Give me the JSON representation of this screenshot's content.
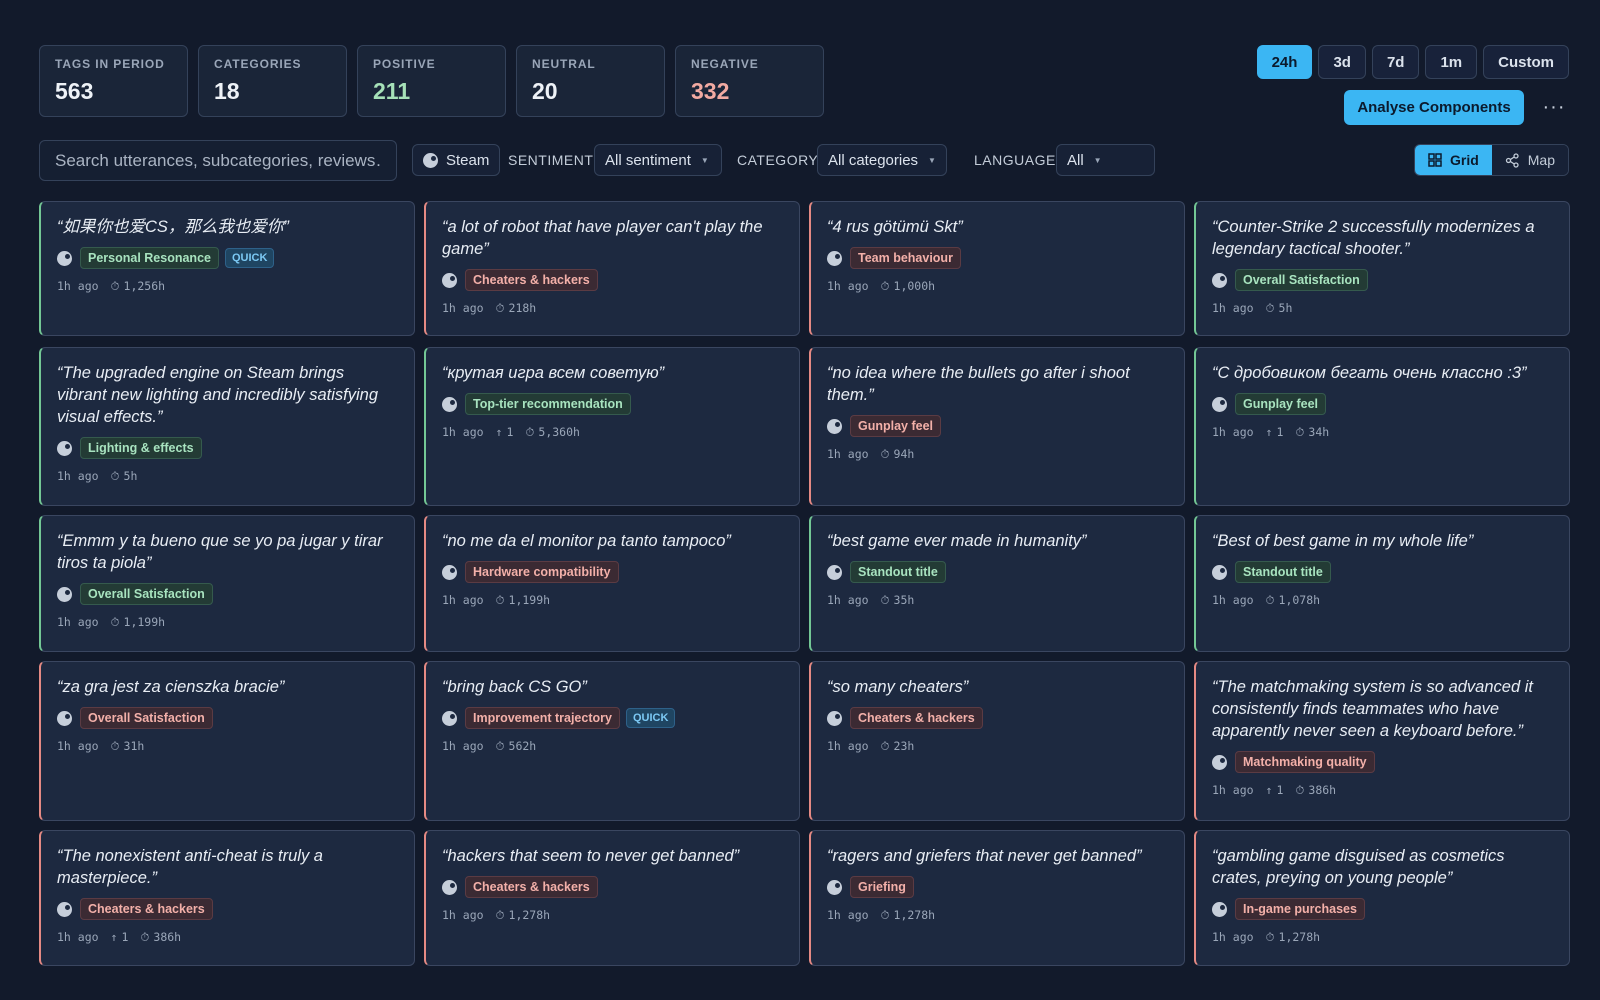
{
  "stats": [
    {
      "label": "TAGS IN PERIOD",
      "value": "563",
      "tone": ""
    },
    {
      "label": "CATEGORIES",
      "value": "18",
      "tone": ""
    },
    {
      "label": "POSITIVE",
      "value": "211",
      "tone": "pos"
    },
    {
      "label": "NEUTRAL",
      "value": "20",
      "tone": ""
    },
    {
      "label": "NEGATIVE",
      "value": "332",
      "tone": "neg"
    }
  ],
  "range": {
    "options": [
      "24h",
      "3d",
      "7d",
      "1m",
      "Custom"
    ],
    "active": "24h"
  },
  "analyse_label": "Analyse Components",
  "more_label": "···",
  "search": {
    "placeholder": "Search utterances, subcategories, reviews…"
  },
  "filters": {
    "source_chip": "Steam",
    "sentiment_label": "SENTIMENT",
    "sentiment_value": "All sentiment",
    "category_label": "CATEGORY",
    "category_value": "All categories",
    "language_label": "LANGUAGE",
    "language_value": "All"
  },
  "view": {
    "grid_label": "Grid",
    "map_label": "Map"
  },
  "cards": [
    {
      "quote": "“如果你也爱CS，那么我也爱你”",
      "tag": "Personal Resonance",
      "sentiment": "pos",
      "quick": "QUICK",
      "time": "1h ago",
      "up": "",
      "playtime": "1,256h"
    },
    {
      "quote": "“a lot of robot that have player can't play the game”",
      "tag": "Cheaters & hackers",
      "sentiment": "neg",
      "quick": "",
      "time": "1h ago",
      "up": "",
      "playtime": "218h"
    },
    {
      "quote": "“4 rus götümü Skt”",
      "tag": "Team behaviour",
      "sentiment": "neg",
      "quick": "",
      "time": "1h ago",
      "up": "",
      "playtime": "1,000h"
    },
    {
      "quote": "“Counter-Strike 2 successfully modernizes a legendary tactical shooter.”",
      "tag": "Overall Satisfaction",
      "sentiment": "pos",
      "quick": "",
      "time": "1h ago",
      "up": "",
      "playtime": "5h"
    },
    {
      "quote": "“The upgraded engine on Steam brings vibrant new lighting and incredibly satisfying visual effects.”",
      "tag": "Lighting & effects",
      "sentiment": "pos",
      "quick": "",
      "time": "1h ago",
      "up": "",
      "playtime": "5h"
    },
    {
      "quote": "“крутая игра всем советую”",
      "tag": "Top-tier recommendation",
      "sentiment": "pos",
      "quick": "",
      "time": "1h ago",
      "up": "1",
      "playtime": "5,360h"
    },
    {
      "quote": "“no idea where the bullets go after i shoot them.”",
      "tag": "Gunplay feel",
      "sentiment": "neg",
      "quick": "",
      "time": "1h ago",
      "up": "",
      "playtime": "94h"
    },
    {
      "quote": "“С дробовиком бегать очень классно :3”",
      "tag": "Gunplay feel",
      "sentiment": "pos",
      "quick": "",
      "time": "1h ago",
      "up": "1",
      "playtime": "34h"
    },
    {
      "quote": "“Emmm y ta bueno que se yo pa jugar y tirar tiros ta piola”",
      "tag": "Overall Satisfaction",
      "sentiment": "pos",
      "quick": "",
      "time": "1h ago",
      "up": "",
      "playtime": "1,199h"
    },
    {
      "quote": "“no me da el monitor pa tanto tampoco”",
      "tag": "Hardware compatibility",
      "sentiment": "neg",
      "quick": "",
      "time": "1h ago",
      "up": "",
      "playtime": "1,199h"
    },
    {
      "quote": "“best game ever made in humanity”",
      "tag": "Standout title",
      "sentiment": "pos",
      "quick": "",
      "time": "1h ago",
      "up": "",
      "playtime": "35h"
    },
    {
      "quote": "“Best of best game in my whole life”",
      "tag": "Standout title",
      "sentiment": "pos",
      "quick": "",
      "time": "1h ago",
      "up": "",
      "playtime": "1,078h"
    },
    {
      "quote": "“za gra jest za cienszka bracie”",
      "tag": "Overall Satisfaction",
      "sentiment": "neg",
      "quick": "",
      "time": "1h ago",
      "up": "",
      "playtime": "31h"
    },
    {
      "quote": "“bring back CS GO”",
      "tag": "Improvement trajectory",
      "sentiment": "neg",
      "quick": "QUICK",
      "time": "1h ago",
      "up": "",
      "playtime": "562h"
    },
    {
      "quote": "“so many cheaters”",
      "tag": "Cheaters & hackers",
      "sentiment": "neg",
      "quick": "",
      "time": "1h ago",
      "up": "",
      "playtime": "23h"
    },
    {
      "quote": "“The matchmaking system is so advanced it consistently finds teammates who have apparently never seen a keyboard before.”",
      "tag": "Matchmaking quality",
      "sentiment": "neg",
      "quick": "",
      "time": "1h ago",
      "up": "1",
      "playtime": "386h"
    },
    {
      "quote": "“The nonexistent anti-cheat is truly a masterpiece.”",
      "tag": "Cheaters & hackers",
      "sentiment": "neg",
      "quick": "",
      "time": "1h ago",
      "up": "1",
      "playtime": "386h"
    },
    {
      "quote": "“hackers that seem to never get banned”",
      "tag": "Cheaters & hackers",
      "sentiment": "neg",
      "quick": "",
      "time": "1h ago",
      "up": "",
      "playtime": "1,278h"
    },
    {
      "quote": "“ragers and griefers that never get banned”",
      "tag": "Griefing",
      "sentiment": "neg",
      "quick": "",
      "time": "1h ago",
      "up": "",
      "playtime": "1,278h"
    },
    {
      "quote": "“gambling game disguised as cosmetics crates, preying on young people”",
      "tag": "In-game purchases",
      "sentiment": "neg",
      "quick": "",
      "time": "1h ago",
      "up": "",
      "playtime": "1,278h"
    }
  ]
}
